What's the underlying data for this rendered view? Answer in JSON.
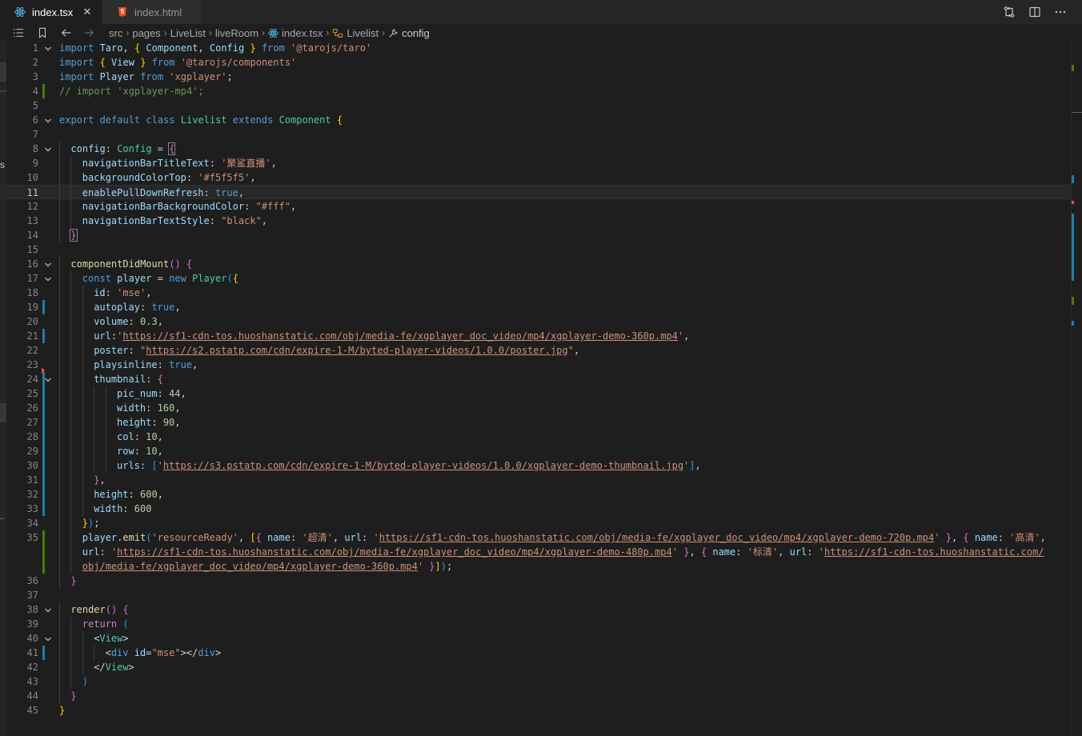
{
  "tabs": [
    {
      "label": "index.tsx",
      "icon": "react-icon",
      "active": true,
      "close": "✕"
    },
    {
      "label": "index.html",
      "icon": "html5-icon",
      "active": false,
      "close": ""
    }
  ],
  "editor_actions": [
    "compare-changes-icon",
    "split-editor-icon",
    "more-actions-icon"
  ],
  "breadcrumb": [
    {
      "label": "src",
      "icon": ""
    },
    {
      "label": "pages",
      "icon": ""
    },
    {
      "label": "LiveList",
      "icon": ""
    },
    {
      "label": "liveRoom",
      "icon": ""
    },
    {
      "label": "index.tsx",
      "icon": "react-icon"
    },
    {
      "label": "Livelist",
      "icon": "class-icon"
    },
    {
      "label": "config",
      "icon": "wrench-icon"
    }
  ],
  "current_line": 11,
  "code_lines": [
    {
      "n": "1",
      "fold": true,
      "indent": 0,
      "tokens": [
        [
          "kw",
          "import"
        ],
        [
          "var",
          " Taro"
        ],
        [
          "punc",
          ", "
        ],
        [
          "brk1",
          "{"
        ],
        [
          "var",
          " Component"
        ],
        [
          "punc",
          ", "
        ],
        [
          "var",
          "Config "
        ],
        [
          "brk1",
          "}"
        ],
        [
          "kw",
          " from"
        ],
        [
          "str",
          " '@tarojs/taro'"
        ]
      ]
    },
    {
      "n": "2",
      "indent": 0,
      "tokens": [
        [
          "kw",
          "import"
        ],
        [
          "punc",
          " "
        ],
        [
          "brk1",
          "{"
        ],
        [
          "var",
          " View "
        ],
        [
          "brk1",
          "}"
        ],
        [
          "kw",
          " from"
        ],
        [
          "str",
          " '@tarojs/components'"
        ]
      ]
    },
    {
      "n": "3",
      "indent": 0,
      "tokens": [
        [
          "kw",
          "import"
        ],
        [
          "var",
          " Player"
        ],
        [
          "kw",
          " from"
        ],
        [
          "str",
          " 'xgplayer'"
        ],
        [
          "punc",
          ";"
        ]
      ]
    },
    {
      "n": "4",
      "gutter": "added",
      "indent": 0,
      "tokens": [
        [
          "cmt",
          "// import 'xgplayer-mp4';"
        ]
      ]
    },
    {
      "n": "5",
      "indent": 0,
      "tokens": []
    },
    {
      "n": "6",
      "fold": true,
      "indent": 0,
      "tokens": [
        [
          "kw",
          "export"
        ],
        [
          "kw",
          " default"
        ],
        [
          "kw",
          " class"
        ],
        [
          "cls",
          " Livelist"
        ],
        [
          "kw",
          " extends"
        ],
        [
          "cls",
          " Component"
        ],
        [
          "punc",
          " "
        ],
        [
          "brk1",
          "{"
        ]
      ]
    },
    {
      "n": "7",
      "indent": 0,
      "tokens": []
    },
    {
      "n": "8",
      "fold": true,
      "indent": 1,
      "tokens": [
        [
          "var",
          "config"
        ],
        [
          "punc",
          ": "
        ],
        [
          "cls",
          "Config"
        ],
        [
          "punc",
          " = "
        ],
        [
          "brk2",
          "{",
          "m"
        ]
      ]
    },
    {
      "n": "9",
      "indent": 2,
      "tokens": [
        [
          "var",
          "navigationBarTitleText"
        ],
        [
          "punc",
          ": "
        ],
        [
          "str",
          "'聚鲨直播'"
        ],
        [
          "punc",
          ","
        ]
      ]
    },
    {
      "n": "10",
      "indent": 2,
      "tokens": [
        [
          "var",
          "backgroundColorTop"
        ],
        [
          "punc",
          ": "
        ],
        [
          "str",
          "'#f5f5f5'"
        ],
        [
          "punc",
          ","
        ]
      ]
    },
    {
      "n": "11",
      "indent": 2,
      "tokens": [
        [
          "var",
          "enablePullDownRefresh"
        ],
        [
          "punc",
          ": "
        ],
        [
          "kw",
          "true"
        ],
        [
          "punc",
          ","
        ]
      ]
    },
    {
      "n": "12",
      "indent": 2,
      "tokens": [
        [
          "var",
          "navigationBarBackgroundColor"
        ],
        [
          "punc",
          ": "
        ],
        [
          "str",
          "\"#fff\""
        ],
        [
          "punc",
          ","
        ]
      ]
    },
    {
      "n": "13",
      "indent": 2,
      "tokens": [
        [
          "var",
          "navigationBarTextStyle"
        ],
        [
          "punc",
          ": "
        ],
        [
          "str",
          "\"black\""
        ],
        [
          "punc",
          ","
        ]
      ]
    },
    {
      "n": "14",
      "indent": 1,
      "tokens": [
        [
          "brk2",
          "}",
          "m"
        ]
      ]
    },
    {
      "n": "15",
      "indent": 0,
      "tokens": []
    },
    {
      "n": "16",
      "fold": true,
      "indent": 1,
      "tokens": [
        [
          "fn",
          "componentDidMount"
        ],
        [
          "brk2",
          "()"
        ],
        [
          "punc",
          " "
        ],
        [
          "brk2",
          "{"
        ]
      ]
    },
    {
      "n": "17",
      "fold": true,
      "indent": 2,
      "tokens": [
        [
          "kw",
          "const"
        ],
        [
          "var",
          " player"
        ],
        [
          "punc",
          " = "
        ],
        [
          "kw",
          "new"
        ],
        [
          "cls",
          " Player"
        ],
        [
          "brk3",
          "("
        ],
        [
          "brk1",
          "{"
        ]
      ]
    },
    {
      "n": "18",
      "indent": 3,
      "tokens": [
        [
          "var",
          "id"
        ],
        [
          "punc",
          ": "
        ],
        [
          "str",
          "'mse'"
        ],
        [
          "punc",
          ","
        ]
      ]
    },
    {
      "n": "19",
      "gutter": "modified",
      "indent": 3,
      "tokens": [
        [
          "var",
          "autoplay"
        ],
        [
          "punc",
          ": "
        ],
        [
          "kw",
          "true"
        ],
        [
          "punc",
          ","
        ]
      ]
    },
    {
      "n": "20",
      "indent": 3,
      "tokens": [
        [
          "var",
          "volume"
        ],
        [
          "punc",
          ": "
        ],
        [
          "num",
          "0.3"
        ],
        [
          "punc",
          ","
        ]
      ]
    },
    {
      "n": "21",
      "gutter": "modified",
      "indent": 3,
      "tokens": [
        [
          "var",
          "url"
        ],
        [
          "punc",
          ":"
        ],
        [
          "str",
          "'"
        ],
        [
          "url",
          "https://sf1-cdn-tos.huoshanstatic.com/obj/media-fe/xgplayer_doc_video/mp4/xgplayer-demo-360p.mp4"
        ],
        [
          "str",
          "'"
        ],
        [
          "punc",
          ","
        ]
      ]
    },
    {
      "n": "22",
      "indent": 3,
      "tokens": [
        [
          "var",
          "poster"
        ],
        [
          "punc",
          ": "
        ],
        [
          "str",
          "\""
        ],
        [
          "url",
          "https://s2.pstatp.com/cdn/expire-1-M/byted-player-videos/1.0.0/poster.jpg"
        ],
        [
          "str",
          "\""
        ],
        [
          "punc",
          ","
        ]
      ]
    },
    {
      "n": "23",
      "gutter": "deleted",
      "indent": 3,
      "tokens": [
        [
          "var",
          "playsinline"
        ],
        [
          "punc",
          ": "
        ],
        [
          "kw",
          "true"
        ],
        [
          "punc",
          ","
        ]
      ]
    },
    {
      "n": "24",
      "fold": true,
      "gutter": "modified",
      "indent": 3,
      "tokens": [
        [
          "var",
          "thumbnail"
        ],
        [
          "punc",
          ": "
        ],
        [
          "brk2",
          "{"
        ]
      ]
    },
    {
      "n": "25",
      "gutter": "modified",
      "indent": 5,
      "tokens": [
        [
          "var",
          "pic_num"
        ],
        [
          "punc",
          ": "
        ],
        [
          "num",
          "44"
        ],
        [
          "punc",
          ","
        ]
      ]
    },
    {
      "n": "26",
      "gutter": "modified",
      "indent": 5,
      "tokens": [
        [
          "var",
          "width"
        ],
        [
          "punc",
          ": "
        ],
        [
          "num",
          "160"
        ],
        [
          "punc",
          ","
        ]
      ]
    },
    {
      "n": "27",
      "gutter": "modified",
      "indent": 5,
      "tokens": [
        [
          "var",
          "height"
        ],
        [
          "punc",
          ": "
        ],
        [
          "num",
          "90"
        ],
        [
          "punc",
          ","
        ]
      ]
    },
    {
      "n": "28",
      "gutter": "modified",
      "indent": 5,
      "tokens": [
        [
          "var",
          "col"
        ],
        [
          "punc",
          ": "
        ],
        [
          "num",
          "10"
        ],
        [
          "punc",
          ","
        ]
      ]
    },
    {
      "n": "29",
      "gutter": "modified",
      "indent": 5,
      "tokens": [
        [
          "var",
          "row"
        ],
        [
          "punc",
          ": "
        ],
        [
          "num",
          "10"
        ],
        [
          "punc",
          ","
        ]
      ]
    },
    {
      "n": "30",
      "gutter": "modified",
      "indent": 5,
      "tokens": [
        [
          "var",
          "urls"
        ],
        [
          "punc",
          ": "
        ],
        [
          "brk3",
          "["
        ],
        [
          "str",
          "'"
        ],
        [
          "url",
          "https://s3.pstatp.com/cdn/expire-1-M/byted-player-videos/1.0.0/xgplayer-demo-thumbnail.jpg"
        ],
        [
          "str",
          "'"
        ],
        [
          "brk3",
          "]"
        ],
        [
          "punc",
          ","
        ]
      ]
    },
    {
      "n": "31",
      "gutter": "modified",
      "indent": 3,
      "tokens": [
        [
          "brk2",
          "}"
        ],
        [
          "punc",
          ","
        ]
      ]
    },
    {
      "n": "32",
      "gutter": "modified",
      "indent": 3,
      "tokens": [
        [
          "var",
          "height"
        ],
        [
          "punc",
          ": "
        ],
        [
          "num",
          "600"
        ],
        [
          "punc",
          ","
        ]
      ]
    },
    {
      "n": "33",
      "gutter": "modified",
      "indent": 3,
      "tokens": [
        [
          "var",
          "width"
        ],
        [
          "punc",
          ": "
        ],
        [
          "num",
          "600"
        ]
      ]
    },
    {
      "n": "34",
      "indent": 2,
      "tokens": [
        [
          "brk1",
          "}"
        ],
        [
          "brk3",
          ")"
        ],
        [
          "punc",
          ";"
        ]
      ]
    },
    {
      "n": "35",
      "gutter": "added",
      "indent": 2,
      "tokens": [
        [
          "var",
          "player"
        ],
        [
          "punc",
          "."
        ],
        [
          "fn",
          "emit"
        ],
        [
          "brk3",
          "("
        ],
        [
          "str",
          "'resourceReady'"
        ],
        [
          "punc",
          ", "
        ],
        [
          "brk1",
          "["
        ],
        [
          "brk2",
          "{"
        ],
        [
          "var",
          " name"
        ],
        [
          "punc",
          ": "
        ],
        [
          "str",
          "'超清'"
        ],
        [
          "punc",
          ", "
        ],
        [
          "var",
          "url"
        ],
        [
          "punc",
          ": "
        ],
        [
          "str",
          "'"
        ],
        [
          "url",
          "https://sf1-cdn-tos.huoshanstatic.com/obj/media-fe/xgplayer_doc_video/mp4/xgplayer-demo-720p.mp4"
        ],
        [
          "str",
          "'"
        ],
        [
          "punc",
          " "
        ],
        [
          "brk2",
          "}"
        ],
        [
          "punc",
          ", "
        ],
        [
          "brk2",
          "{"
        ],
        [
          "var",
          " name"
        ],
        [
          "punc",
          ": "
        ],
        [
          "str",
          "'高清'"
        ],
        [
          "punc",
          ","
        ]
      ]
    },
    {
      "n": "",
      "gutter": "added",
      "indent": 2,
      "tokens": [
        [
          "var",
          "url"
        ],
        [
          "punc",
          ": "
        ],
        [
          "str",
          "'"
        ],
        [
          "url",
          "https://sf1-cdn-tos.huoshanstatic.com/obj/media-fe/xgplayer_doc_video/mp4/xgplayer-demo-480p.mp4"
        ],
        [
          "str",
          "'"
        ],
        [
          "punc",
          " "
        ],
        [
          "brk2",
          "}"
        ],
        [
          "punc",
          ", "
        ],
        [
          "brk2",
          "{"
        ],
        [
          "var",
          " name"
        ],
        [
          "punc",
          ": "
        ],
        [
          "str",
          "'标清'"
        ],
        [
          "punc",
          ", "
        ],
        [
          "var",
          "url"
        ],
        [
          "punc",
          ": "
        ],
        [
          "str",
          "'"
        ],
        [
          "url",
          "https://sf1-cdn-tos.huoshanstatic.com/"
        ]
      ]
    },
    {
      "n": "",
      "gutter": "added",
      "indent": 2,
      "tokens": [
        [
          "url",
          "obj/media-fe/xgplayer_doc_video/mp4/xgplayer-demo-360p.mp4"
        ],
        [
          "str",
          "'"
        ],
        [
          "punc",
          " "
        ],
        [
          "brk2",
          "}"
        ],
        [
          "brk1",
          "]"
        ],
        [
          "brk3",
          ")"
        ],
        [
          "punc",
          ";"
        ]
      ]
    },
    {
      "n": "36",
      "indent": 1,
      "tokens": [
        [
          "brk2",
          "}"
        ]
      ]
    },
    {
      "n": "37",
      "indent": 0,
      "tokens": []
    },
    {
      "n": "38",
      "fold": true,
      "indent": 1,
      "tokens": [
        [
          "fn",
          "render"
        ],
        [
          "brk2",
          "()"
        ],
        [
          "punc",
          " "
        ],
        [
          "brk2",
          "{"
        ]
      ]
    },
    {
      "n": "39",
      "indent": 2,
      "tokens": [
        [
          "ctl",
          "return"
        ],
        [
          "punc",
          " "
        ],
        [
          "brk3",
          "("
        ]
      ]
    },
    {
      "n": "40",
      "fold": true,
      "indent": 3,
      "tokens": [
        [
          "punc",
          "<"
        ],
        [
          "cls",
          "View"
        ],
        [
          "punc",
          ">"
        ]
      ]
    },
    {
      "n": "41",
      "gutter": "modified",
      "indent": 4,
      "tokens": [
        [
          "punc",
          "<"
        ],
        [
          "tag",
          "div"
        ],
        [
          "attr",
          " id"
        ],
        [
          "punc",
          "="
        ],
        [
          "str",
          "\"mse\""
        ],
        [
          "punc",
          "></"
        ],
        [
          "tag",
          "div"
        ],
        [
          "punc",
          ">"
        ]
      ]
    },
    {
      "n": "42",
      "indent": 3,
      "tokens": [
        [
          "punc",
          "</"
        ],
        [
          "cls",
          "View"
        ],
        [
          "punc",
          ">"
        ]
      ]
    },
    {
      "n": "43",
      "indent": 2,
      "tokens": [
        [
          "brk3",
          ")"
        ]
      ]
    },
    {
      "n": "44",
      "indent": 1,
      "tokens": [
        [
          "brk2",
          "}"
        ]
      ]
    },
    {
      "n": "45",
      "indent": 0,
      "tokens": [
        [
          "brk1",
          "}"
        ]
      ]
    }
  ],
  "sidebar_fragments": [
    "s",
    ".."
  ]
}
